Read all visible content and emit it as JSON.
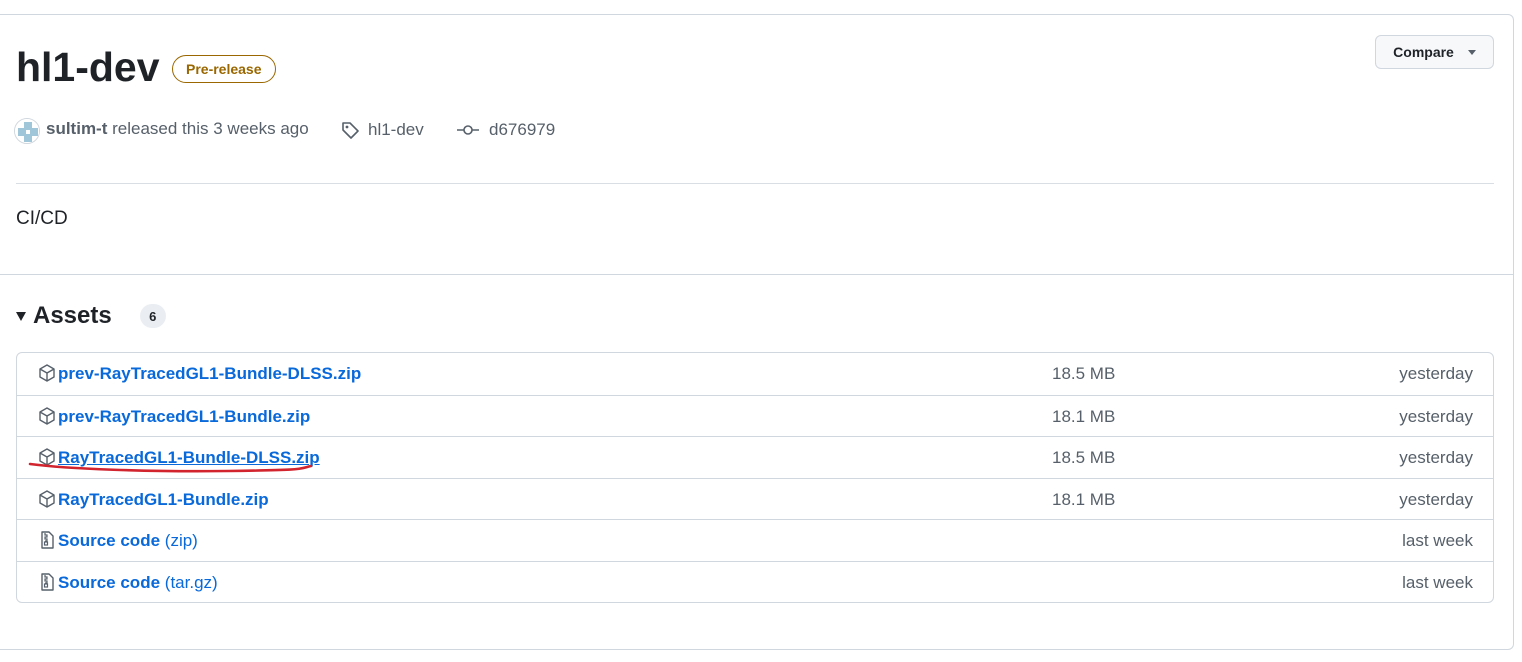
{
  "release": {
    "title": "hl1-dev",
    "badge": "Pre-release",
    "compare_label": "Compare",
    "author": "sultim-t",
    "released_text": "released this 3 weeks ago",
    "tag": "hl1-dev",
    "commit": "d676979",
    "body": "CI/CD"
  },
  "assets": {
    "title": "Assets",
    "count": "6",
    "items": [
      {
        "name": "prev-RayTracedGL1-Bundle-DLSS.zip",
        "ext": "",
        "size": "18.5 MB",
        "date": "yesterday",
        "icon": "package-icon"
      },
      {
        "name": "prev-RayTracedGL1-Bundle.zip",
        "ext": "",
        "size": "18.1 MB",
        "date": "yesterday",
        "icon": "package-icon"
      },
      {
        "name": "RayTracedGL1-Bundle-DLSS.zip",
        "ext": "",
        "size": "18.5 MB",
        "date": "yesterday",
        "icon": "package-icon"
      },
      {
        "name": "RayTracedGL1-Bundle.zip",
        "ext": "",
        "size": "18.1 MB",
        "date": "yesterday",
        "icon": "package-icon"
      },
      {
        "name": "Source code",
        "ext": "(zip)",
        "size": "",
        "date": "last week",
        "icon": "file-zip-icon"
      },
      {
        "name": "Source code",
        "ext": "(tar.gz)",
        "size": "",
        "date": "last week",
        "icon": "file-zip-icon"
      }
    ]
  },
  "colors": {
    "link": "#0969da",
    "badge": "#9a6700",
    "annotation": "#d1242f"
  }
}
